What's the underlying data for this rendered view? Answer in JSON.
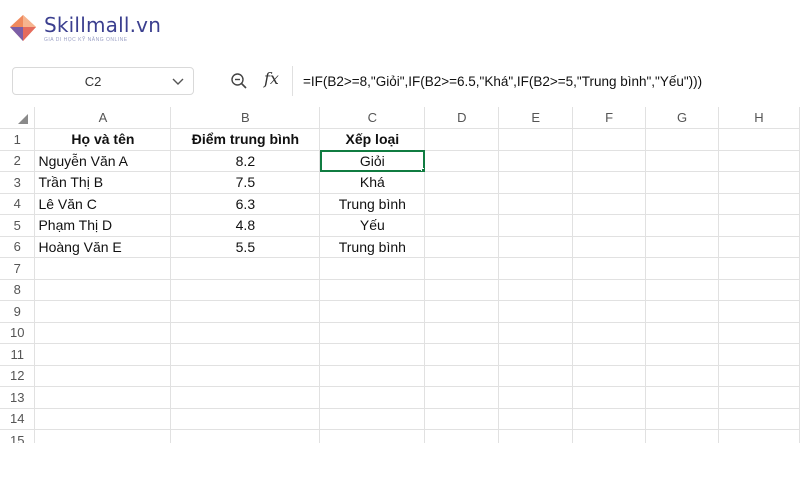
{
  "brand": {
    "name": "Skillmall.vn",
    "tagline": "GIA DI HỌC KỸ NĂNG ONLINE",
    "colors": {
      "primary": "#3b3f8f",
      "accent1": "#f08a5d",
      "accent2": "#7b5ea7"
    }
  },
  "formula_bar": {
    "name_box": "C2",
    "zoom_icon": "zoom-out-icon",
    "fx_label": "fx",
    "formula": "=IF(B2>=8,\"Giỏi\",IF(B2>=6.5,\"Khá\",IF(B2>=5,\"Trung bình\",\"Yếu\")))"
  },
  "sheet": {
    "columns": [
      "A",
      "B",
      "C",
      "D",
      "E",
      "F",
      "G",
      "H"
    ],
    "row_numbers": [
      "1",
      "2",
      "3",
      "4",
      "5",
      "6",
      "7",
      "8",
      "9",
      "10",
      "11",
      "12",
      "13",
      "14",
      "15"
    ],
    "active_column": "C",
    "active_row": "2",
    "header": {
      "a": "Họ và tên",
      "b": "Điểm trung bình",
      "c": "Xếp loại"
    },
    "rows": [
      {
        "name": "Nguyễn Văn A",
        "score": "8.2",
        "grade": "Giỏi"
      },
      {
        "name": "Trần Thị B",
        "score": "7.5",
        "grade": "Khá"
      },
      {
        "name": "Lê Văn C",
        "score": "6.3",
        "grade": "Trung bình"
      },
      {
        "name": "Phạm Thị D",
        "score": "4.8",
        "grade": "Yếu"
      },
      {
        "name": "Hoàng Văn E",
        "score": "5.5",
        "grade": "Trung bình"
      }
    ],
    "accent_color": "#107c41"
  }
}
